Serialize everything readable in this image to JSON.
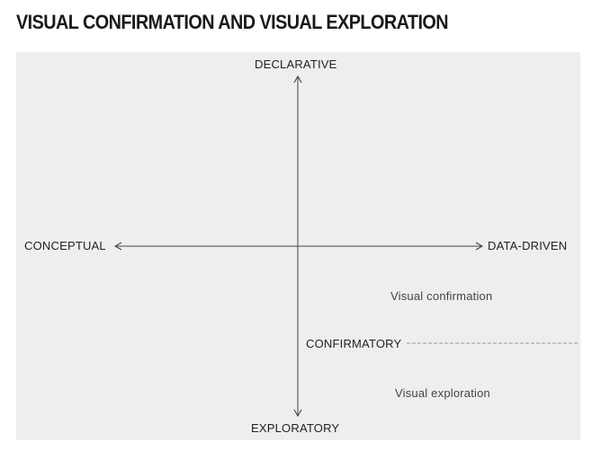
{
  "title": "VISUAL CONFIRMATION AND VISUAL EXPLORATION",
  "axes": {
    "top": "DECLARATIVE",
    "bottom": "EXPLORATORY",
    "left": "CONCEPTUAL",
    "right": "DATA-DRIVEN"
  },
  "divider_label": "CONFIRMATORY",
  "regions": {
    "upper": "Visual confirmation",
    "lower": "Visual exploration"
  },
  "colors": {
    "panel_background": "#eeeeef",
    "axis_line": "#444444",
    "divider_line": "#9a9a9a",
    "text": "#222222"
  }
}
